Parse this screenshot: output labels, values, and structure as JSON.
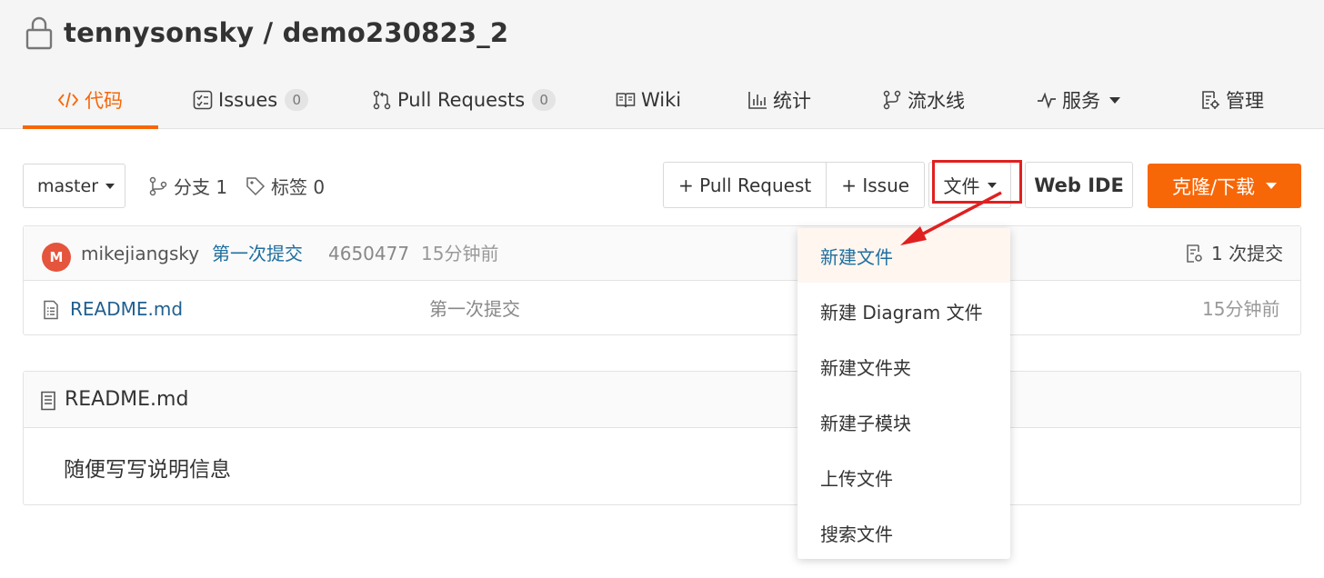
{
  "repo": {
    "title": "tennysonsky / demo230823_2"
  },
  "tabs": [
    {
      "label": "代码",
      "icon": "code-icon"
    },
    {
      "label": "Issues",
      "icon": "issues-icon",
      "count": "0"
    },
    {
      "label": "Pull Requests",
      "icon": "pull-request-icon",
      "count": "0"
    },
    {
      "label": "Wiki",
      "icon": "wiki-icon"
    },
    {
      "label": "统计",
      "icon": "stats-icon"
    },
    {
      "label": "流水线",
      "icon": "pipeline-icon"
    },
    {
      "label": "服务",
      "icon": "pulse-icon"
    },
    {
      "label": "管理",
      "icon": "settings-doc-icon"
    }
  ],
  "toolbar": {
    "branch": "master",
    "branches_label": "分支 1",
    "tags_label": "标签 0",
    "pull_request_button": "+ Pull Request",
    "issue_button": "+ Issue",
    "file_button": "文件",
    "web_ide_button": "Web IDE",
    "clone_button": "克隆/下载"
  },
  "commit": {
    "avatar_letter": "M",
    "author": "mikejiangsky",
    "message": "第一次提交",
    "hash": "4650477",
    "time": "15分钟前",
    "commit_count": "1 次提交"
  },
  "files": [
    {
      "name": "README.md",
      "message": "第一次提交",
      "time": "15分钟前"
    }
  ],
  "readme": {
    "title": "README.md",
    "content": "随便写写说明信息"
  },
  "file_menu": {
    "items": [
      "新建文件",
      "新建 Diagram 文件",
      "新建文件夹",
      "新建子模块",
      "上传文件",
      "搜索文件"
    ]
  },
  "colors": {
    "accent": "#f76707",
    "link": "#1f6f9f",
    "annotation": "#e02020"
  }
}
